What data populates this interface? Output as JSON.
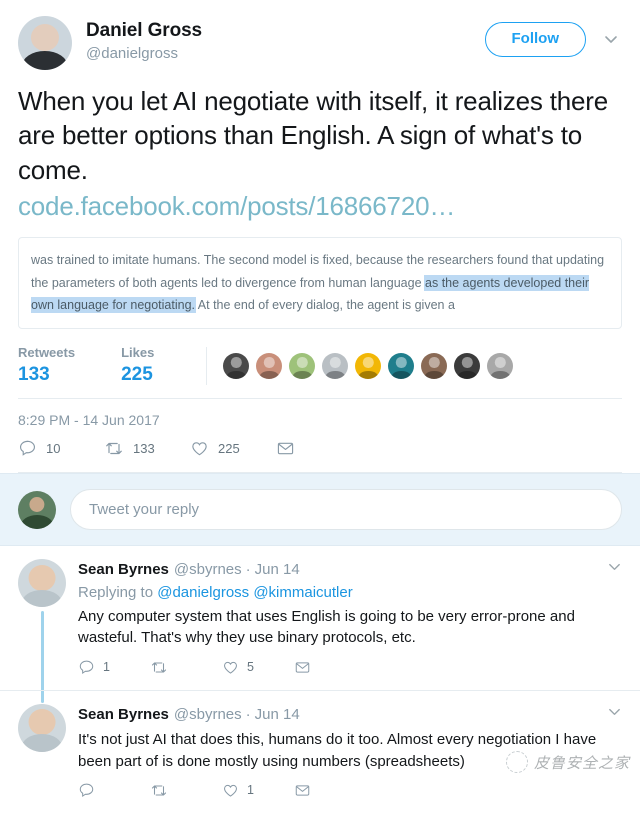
{
  "tweet": {
    "author_name": "Daniel Gross",
    "author_handle": "@danielgross",
    "follow_label": "Follow",
    "more_icon": "chevron-down-icon",
    "text": "When you let AI negotiate with itself, it realizes there are better options than English. A sign of what's to come.",
    "link_text": "code.facebook.com/posts/16866720…",
    "timestamp": "8:29 PM - 14 Jun 2017",
    "quote": {
      "before": "was trained to imitate humans. The second model is fixed, because the researchers found that updating the parameters of both agents led to divergence from human language ",
      "highlight": "as the agents developed their own language for negotiating.",
      "after": " At the end of every dialog, the agent is given a"
    },
    "stats": {
      "retweets_label": "Retweets",
      "retweets_count": "133",
      "likes_label": "Likes",
      "likes_count": "225"
    },
    "facepile_colors": [
      "#4a4a4a",
      "#c98f7a",
      "#9ec27a",
      "#b9bfc4",
      "#f2b705",
      "#1f7e8c",
      "#8a6a55",
      "#3b3b3b",
      "#a8a8a8"
    ],
    "actions": {
      "reply_icon": "comment-icon",
      "reply_count": "10",
      "retweet_icon": "retweet-icon",
      "retweet_count": "133",
      "like_icon": "heart-icon",
      "like_count": "225",
      "share_icon": "envelope-icon",
      "share_count": ""
    }
  },
  "composer": {
    "placeholder": "Tweet your reply"
  },
  "replies": [
    {
      "name": "Sean Byrnes",
      "handle": "@sbyrnes",
      "separator": "·",
      "date": "Jun 14",
      "replying_prefix": "Replying to ",
      "replying_mentions": "@danielgross @kimmaicutler",
      "text": "Any computer system that uses English is going to be very error-prone and wasteful. That's why they use binary protocols, etc.",
      "reply_count": "1",
      "retweet_count": "",
      "like_count": "5",
      "more_icon": "chevron-down-icon"
    },
    {
      "name": "Sean Byrnes",
      "handle": "@sbyrnes",
      "separator": "·",
      "date": "Jun 14",
      "replying_prefix": "",
      "replying_mentions": "",
      "text": "It's not just AI that does this, humans do it too. Almost every negotiation I have been part of is done mostly using numbers (spreadsheets)",
      "reply_count": "",
      "retweet_count": "",
      "like_count": "1",
      "more_icon": "chevron-down-icon"
    }
  ],
  "watermark": {
    "text": "皮鲁安全之家"
  },
  "colors": {
    "accent": "#1da1f2",
    "link": "#7ab8c9",
    "muted": "#8899a6",
    "highlight": "#bcd9f3",
    "composer_bg": "#e9f3fa",
    "thread_line": "#9fd3ec"
  }
}
